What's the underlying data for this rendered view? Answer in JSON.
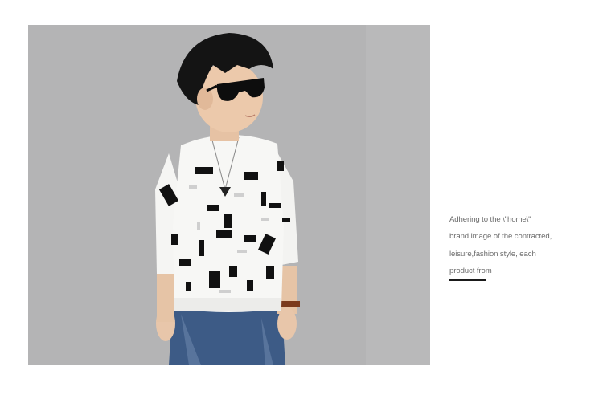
{
  "product_photo": {
    "alt": "",
    "background_color": "#b3b3b4"
  },
  "description": {
    "lines": [
      "Adhering to the \\\"home\\\"",
      "brand image of the contracted,",
      "leisure,fashion style, each",
      "product from"
    ],
    "text_color": "#6c6c6c",
    "accent_color": "#1a1a1a"
  }
}
